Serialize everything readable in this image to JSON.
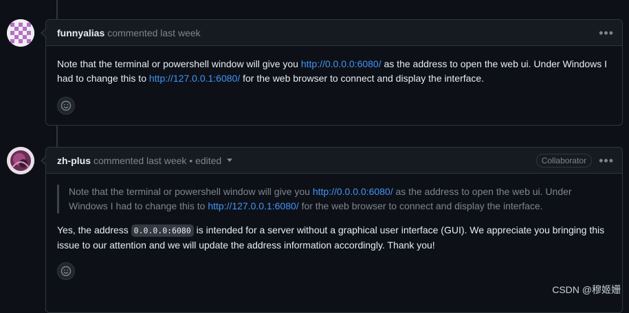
{
  "comments": [
    {
      "author": "funnyalias",
      "meta": "commented last week",
      "body": {
        "p1_pre": "Note that the terminal or powershell window will give you ",
        "link1": "http://0.0.0.0:6080/",
        "p1_mid": " as the address to open the web ui. Under Windows I had to change this to ",
        "link2": "http://127.0.0.1:6080/",
        "p1_post": " for the web browser to connect and display the interface."
      },
      "menu_icon": "kebab-horizontal-icon",
      "reaction_icon": "smiley-icon"
    },
    {
      "author": "zh-plus",
      "meta": "commented last week • edited",
      "badge": "Collaborator",
      "quote": {
        "pre": "Note that the terminal or powershell window will give you ",
        "link1": "http://0.0.0.0:6080/",
        "mid": " as the address to open the web ui. Under Windows I had to change this to ",
        "link2": "http://127.0.0.1:6080/",
        "post": " for the web browser to connect and display the interface."
      },
      "reply": {
        "pre": "Yes, the address ",
        "code": "0.0.0.0:6080",
        "post": " is intended for a server without a graphical user interface (GUI). We appreciate you bringing this issue to our attention and we will update the address information accordingly. Thank you!"
      },
      "menu_icon": "kebab-horizontal-icon",
      "reaction_icon": "smiley-icon"
    }
  ],
  "watermark": "CSDN @穆姬姗",
  "colors": {
    "background": "#0d1117",
    "header": "#161b22",
    "border": "#30363d",
    "link": "#4493f8",
    "muted": "#7d8590",
    "text": "#e6edf3"
  }
}
